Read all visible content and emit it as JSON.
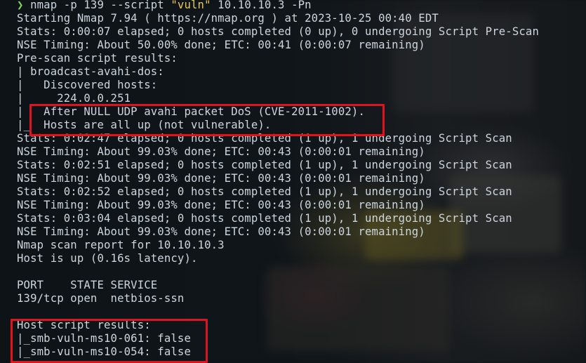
{
  "terminal": {
    "command": {
      "arrow": "❯",
      "before": " nmap -p 139 --script ",
      "string": "\"vuln\"",
      "after": " 10.10.10.3 -Pn"
    },
    "lines": [
      "Starting Nmap 7.94 ( https://nmap.org ) at 2023-10-25 00:40 EDT",
      "Stats: 0:00:07 elapsed; 0 hosts completed (0 up), 0 undergoing Script Pre-Scan",
      "NSE Timing: About 50.00% done; ETC: 00:41 (0:00:07 remaining)",
      "Pre-scan script results:",
      "| broadcast-avahi-dos:",
      "|   Discovered hosts:",
      "|     224.0.0.251",
      "|   After NULL UDP avahi packet DoS (CVE-2011-1002).",
      "|_  Hosts are all up (not vulnerable).",
      "Stats: 0:02:47 elapsed; 0 hosts completed (1 up), 1 undergoing Script Scan",
      "NSE Timing: About 99.03% done; ETC: 00:43 (0:00:01 remaining)",
      "Stats: 0:02:51 elapsed; 0 hosts completed (1 up), 1 undergoing Script Scan",
      "NSE Timing: About 99.03% done; ETC: 00:43 (0:00:01 remaining)",
      "Stats: 0:02:52 elapsed; 0 hosts completed (1 up), 1 undergoing Script Scan",
      "NSE Timing: About 99.03% done; ETC: 00:43 (0:00:01 remaining)",
      "Stats: 0:03:04 elapsed; 0 hosts completed (1 up), 1 undergoing Script Scan",
      "NSE Timing: About 99.03% done; ETC: 00:43 (0:00:01 remaining)",
      "Nmap scan report for 10.10.10.3",
      "Host is up (0.16s latency).",
      "",
      "PORT    STATE SERVICE",
      "139/tcp open  netbios-ssn",
      "",
      "Host script results:",
      "|_smb-vuln-ms10-061: false",
      "|_smb-vuln-ms10-054: false"
    ]
  },
  "colors": {
    "background": "#0f1418",
    "text": "#cdd5df",
    "prompt_arrow": "#7ed957",
    "string_literal": "#e6c65c",
    "highlight_box": "#e0141e"
  }
}
